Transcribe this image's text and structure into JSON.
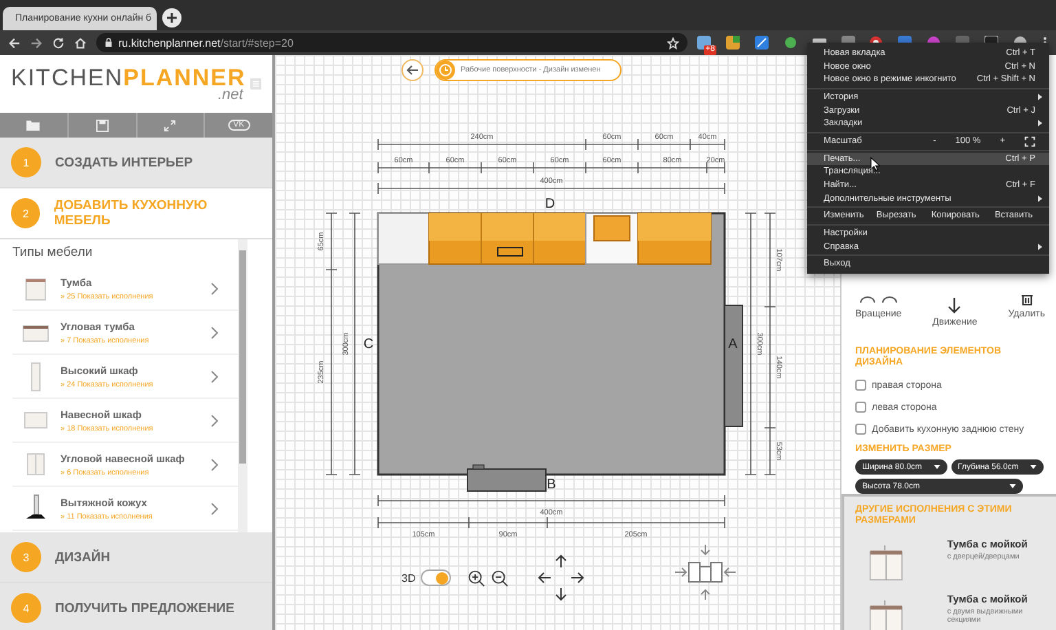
{
  "browser": {
    "tab_title": "Планирование кухни онлайн б",
    "url_host": "ru.kitchenplanner.net",
    "url_path": "/start/#step=20",
    "extension_badge": "+8"
  },
  "sidebar": {
    "logo": {
      "primary": "KITCHEN",
      "accent": "PLANNER",
      "suffix": ".net"
    },
    "toolbar_badge": "VK",
    "steps": [
      {
        "number": "1",
        "label": "СОЗДАТЬ ИНТЕРЬЕР",
        "selected": false
      },
      {
        "number": "2",
        "label": "ДОБАВИТЬ КУХОННУЮ МЕБЕЛЬ",
        "selected": true
      },
      {
        "number": "3",
        "label": "ДИЗАЙН",
        "selected": false
      },
      {
        "number": "4",
        "label": "ПОЛУЧИТЬ ПРЕДЛОЖЕНИЕ",
        "selected": false
      }
    ],
    "section_title": "Типы мебели",
    "furniture_types": [
      {
        "kind": "base",
        "name": "Тумба",
        "link": "» 25 Показать исполнения"
      },
      {
        "kind": "corner_base",
        "name": "Угловая тумба",
        "link": "» 7 Показать исполнения"
      },
      {
        "kind": "tall",
        "name": "Высокий шкаф",
        "link": "» 24 Показать исполнения"
      },
      {
        "kind": "wall",
        "name": "Навесной шкаф",
        "link": "» 18 Показать исполнения"
      },
      {
        "kind": "corner_wall",
        "name": "Угловой навесной шкаф",
        "link": "» 6 Показать исполнения"
      },
      {
        "kind": "hood",
        "name": "Вытяжной кожух",
        "link": "» 11 Показать исполнения"
      }
    ]
  },
  "canvas": {
    "history_label": "Рабочие поверхности - Дизайн изменен",
    "walls": [
      "D",
      "C",
      "A",
      "B"
    ],
    "dimensions": {
      "top_outer": [
        "240cm",
        "60cm",
        "60cm",
        "40cm"
      ],
      "top_inner": [
        "60cm",
        "60cm",
        "60cm",
        "60cm",
        "60cm",
        "80cm",
        "20cm"
      ],
      "top_total": "400cm",
      "left_parts": [
        "65cm",
        "235cm"
      ],
      "left_total": "300cm",
      "right_total": "300cm",
      "right_parts": [
        "107cm",
        "140cm",
        "53cm"
      ],
      "bottom_total": "400cm",
      "bottom_parts": [
        "105cm",
        "90cm",
        "205cm"
      ]
    },
    "view_3d": {
      "label": "3D",
      "on": true
    }
  },
  "right_panel": {
    "actions": [
      {
        "kind": "rotate",
        "label": "Вращение"
      },
      {
        "kind": "move",
        "label": "Движение"
      },
      {
        "kind": "delete",
        "label": "Удалить"
      }
    ],
    "planning_title": "ПЛАНИРОВАНИЕ ЭЛЕМЕНТОВ ДИЗАЙНА",
    "options": [
      {
        "label": "правая сторона",
        "checked": false
      },
      {
        "label": "левая сторона",
        "checked": false
      },
      {
        "label": "Добавить кухонную заднюю стену",
        "checked": false
      }
    ],
    "resize_title": "ИЗМЕНИТЬ РАЗМЕР",
    "sizes": [
      "Ширина 80.0cm",
      "Глубина 56.0cm",
      "Высота 78.0cm"
    ],
    "variants_title": "ДРУГИЕ ИСПОЛНЕНИЯ С ЭТИМИ РАЗМЕРАМИ",
    "variants": [
      {
        "name": "Тумба с мойкой",
        "description": "с дверцей/дверцами"
      },
      {
        "name": "Тумба с мойкой",
        "description": "с двумя выдвижными секциями"
      }
    ]
  },
  "browser_menu": {
    "items": [
      {
        "kind": "item",
        "label": "Новая вкладка",
        "shortcut": "Ctrl + T",
        "submenu": false,
        "selected": false
      },
      {
        "kind": "item",
        "label": "Новое окно",
        "shortcut": "Ctrl + N",
        "submenu": false,
        "selected": false
      },
      {
        "kind": "item",
        "label": "Новое окно в режиме инкогнито",
        "shortcut": "Ctrl + Shift + N",
        "submenu": false,
        "selected": false
      },
      {
        "kind": "separator"
      },
      {
        "kind": "item",
        "label": "История",
        "submenu": true,
        "selected": false
      },
      {
        "kind": "item",
        "label": "Загрузки",
        "shortcut": "Ctrl + J",
        "submenu": false,
        "selected": false
      },
      {
        "kind": "item",
        "label": "Закладки",
        "submenu": true,
        "selected": false
      },
      {
        "kind": "separator"
      },
      {
        "kind": "zoom",
        "label": "Масштаб",
        "minus": "-",
        "value": "100 %",
        "plus": "+"
      },
      {
        "kind": "separator"
      },
      {
        "kind": "item",
        "label": "Печать...",
        "shortcut": "Ctrl + P",
        "submenu": false,
        "selected": true
      },
      {
        "kind": "item",
        "label": "Трансляция...",
        "submenu": false,
        "selected": false
      },
      {
        "kind": "item",
        "label": "Найти...",
        "shortcut": "Ctrl + F",
        "submenu": false,
        "selected": false
      },
      {
        "kind": "item",
        "label": "Дополнительные инструменты",
        "submenu": true,
        "selected": false
      },
      {
        "kind": "separator"
      },
      {
        "kind": "edit",
        "label": "Изменить",
        "actions": [
          "Вырезать",
          "Копировать",
          "Вставить"
        ]
      },
      {
        "kind": "separator"
      },
      {
        "kind": "item",
        "label": "Настройки",
        "submenu": false,
        "selected": false
      },
      {
        "kind": "item",
        "label": "Справка",
        "submenu": true,
        "selected": false
      },
      {
        "kind": "separator"
      },
      {
        "kind": "item",
        "label": "Выход",
        "submenu": false,
        "selected": false
      }
    ]
  }
}
